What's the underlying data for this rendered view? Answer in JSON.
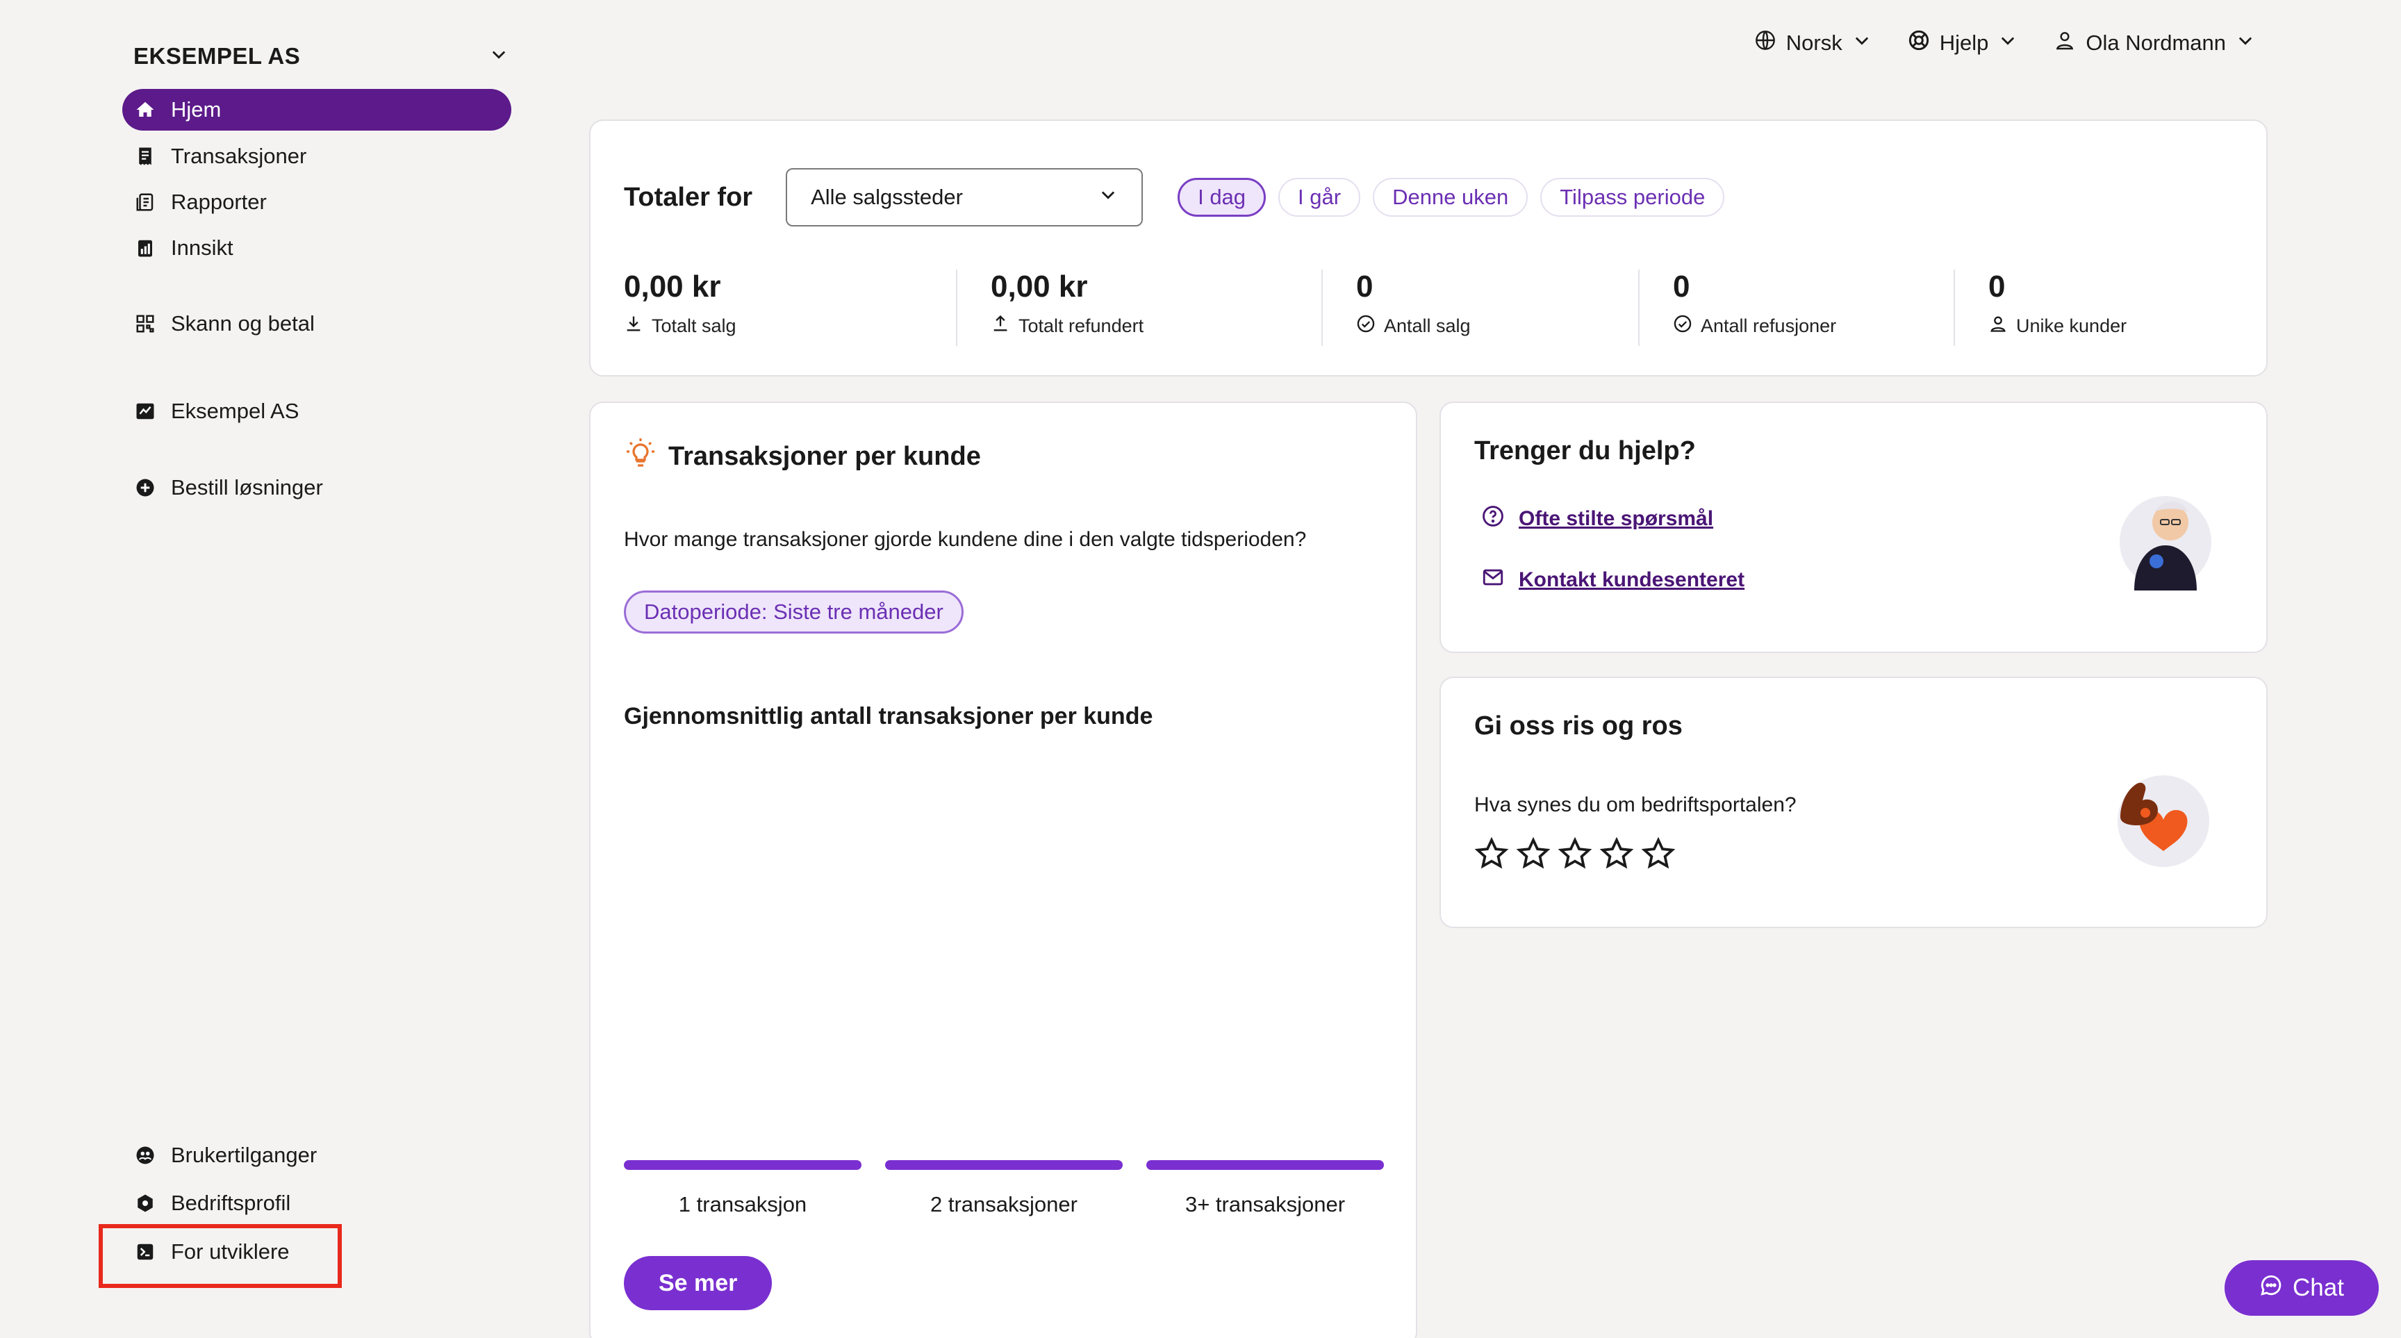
{
  "sidebar": {
    "company": "EKSEMPEL AS",
    "items": [
      {
        "label": "Hjem",
        "icon": "home-icon",
        "active": true
      },
      {
        "label": "Transaksjoner",
        "icon": "receipt-icon"
      },
      {
        "label": "Rapporter",
        "icon": "report-icon"
      },
      {
        "label": "Innsikt",
        "icon": "insight-icon"
      },
      {
        "label": "Skann og betal",
        "icon": "qr-icon"
      },
      {
        "label": "Eksempel AS",
        "icon": "store-icon"
      },
      {
        "label": "Bestill løsninger",
        "icon": "plus-circle-icon"
      }
    ],
    "bottom_items": [
      {
        "label": "Brukertilganger",
        "icon": "users-icon"
      },
      {
        "label": "Bedriftsprofil",
        "icon": "gear-icon"
      },
      {
        "label": "For utviklere",
        "icon": "terminal-icon"
      }
    ]
  },
  "topbar": {
    "language": "Norsk",
    "help": "Hjelp",
    "user": "Ola Nordmann"
  },
  "totals": {
    "title": "Totaler for",
    "select_value": "Alle salgssteder",
    "periods": [
      "I dag",
      "I går",
      "Denne uken",
      "Tilpass periode"
    ],
    "selected_period": "I dag",
    "stats": [
      {
        "value": "0,00 kr",
        "label": "Totalt salg"
      },
      {
        "value": "0,00 kr",
        "label": "Totalt refundert"
      },
      {
        "value": "0",
        "label": "Antall salg"
      },
      {
        "value": "0",
        "label": "Antall refusjoner"
      },
      {
        "value": "0",
        "label": "Unike kunder"
      }
    ]
  },
  "transactions_card": {
    "title": "Transaksjoner per kunde",
    "question": "Hvor mange transaksjoner gjorde kundene dine i den valgte tidsperioden?",
    "chip": "Datoperiode: Siste tre måneder",
    "subtitle": "Gjennomsnittlig antall transaksjoner per kunde",
    "bars": [
      "1 transaksjon",
      "2 transaksjoner",
      "3+ transaksjoner"
    ],
    "button": "Se mer"
  },
  "help_card": {
    "title": "Trenger du hjelp?",
    "links": [
      "Ofte stilte spørsmål",
      "Kontakt kundesenteret"
    ]
  },
  "feedback_card": {
    "title": "Gi oss ris og ros",
    "question": "Hva synes du om bedriftsportalen?",
    "stars": 5
  },
  "chat": {
    "label": "Chat"
  },
  "colors": {
    "accent": "#7a2fd0",
    "active_nav": "#5c1a8a",
    "highlight": "#e8291c"
  }
}
